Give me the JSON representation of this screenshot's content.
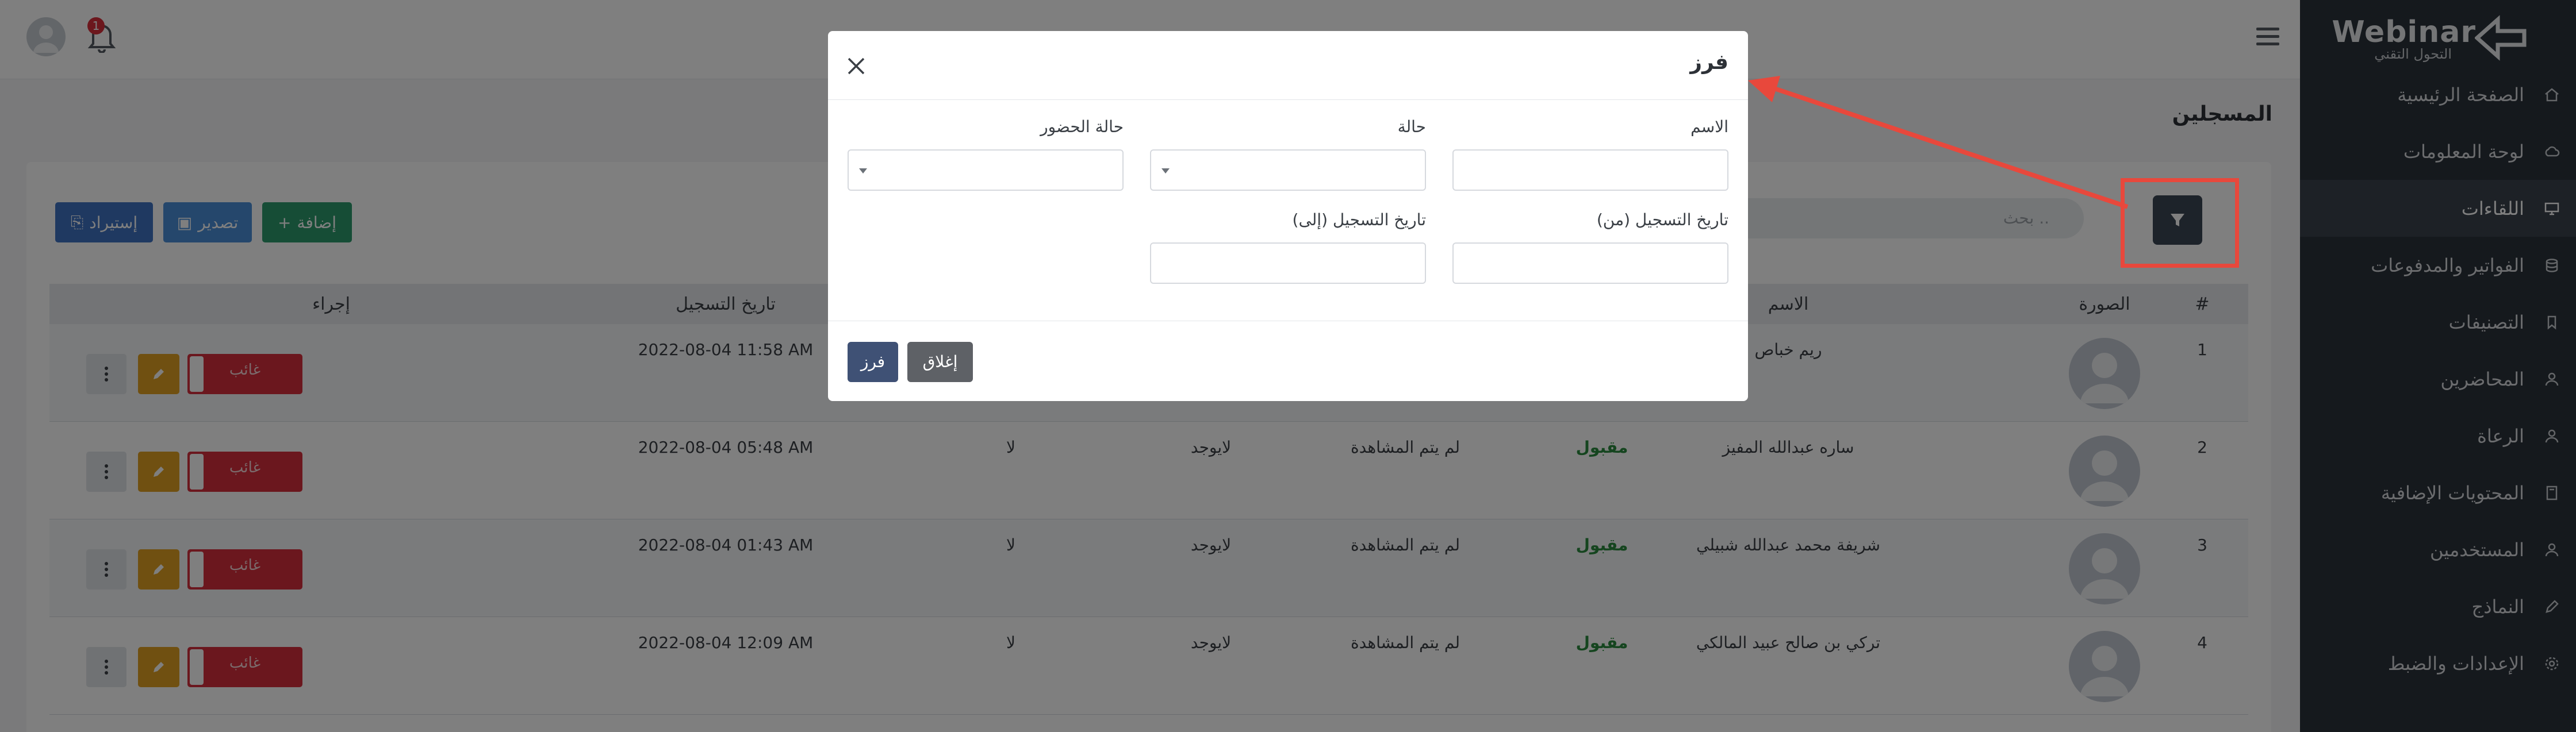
{
  "sidebar": {
    "logo_text": "Webinar",
    "logo_sub": "التحول التقني",
    "items": [
      {
        "label": "الصفحة الرئيسية",
        "icon": "home-icon"
      },
      {
        "label": "لوحة المعلومات",
        "icon": "cloud-icon"
      },
      {
        "label": "اللقاءات",
        "icon": "monitor-icon",
        "active": true
      },
      {
        "label": "الفواتير والمدفوعات",
        "icon": "database-icon"
      },
      {
        "label": "التصنيفات",
        "icon": "bookmark-icon"
      },
      {
        "label": "المحاضرين",
        "icon": "user-icon"
      },
      {
        "label": "الرعاة",
        "icon": "user-icon"
      },
      {
        "label": "المحتويات الإضافية",
        "icon": "book-icon"
      },
      {
        "label": "المستخدمين",
        "icon": "user-icon"
      },
      {
        "label": "النماذج",
        "icon": "edit-icon"
      },
      {
        "label": "الإعدادات والضبط",
        "icon": "gear-icon"
      }
    ]
  },
  "topbar": {
    "notification_count": "1"
  },
  "page": {
    "title": "المسجلين",
    "search_placeholder": "بحث ..",
    "add_label": "إضافة",
    "export_label": "تصدير",
    "import_label": "إستيراد"
  },
  "table": {
    "headers": {
      "num": "#",
      "photo": "الصورة",
      "name": "الاسم",
      "registration_date": "تاريخ التسجيل",
      "action": "إجراء"
    },
    "absent_label": "غائب",
    "rows": [
      {
        "num": "1",
        "name": "ريم خباص",
        "status": "",
        "watch": "",
        "cert": "",
        "paid": "",
        "date": "2022-08-04 11:58 AM"
      },
      {
        "num": "2",
        "name": "ساره عبدالله المفيز",
        "status": "مقبول",
        "watch": "لم يتم المشاهدة",
        "cert": "لايوجد",
        "paid": "لا",
        "date": "2022-08-04 05:48 AM"
      },
      {
        "num": "3",
        "name": "شريفة محمد عبدالله شبيلي",
        "status": "مقبول",
        "watch": "لم يتم المشاهدة",
        "cert": "لايوجد",
        "paid": "لا",
        "date": "2022-08-04 01:43 AM"
      },
      {
        "num": "4",
        "name": "تركي بن صالح عبيد المالكي",
        "status": "مقبول",
        "watch": "لم يتم المشاهدة",
        "cert": "لايوجد",
        "paid": "لا",
        "date": "2022-08-04 12:09 AM"
      }
    ]
  },
  "modal": {
    "title": "فرز",
    "fields": {
      "name_label": "الاسم",
      "status_label": "حالة",
      "attendance_label": "حالة الحضور",
      "date_from_label": "تاريخ التسجيل (من)",
      "date_to_label": "تاريخ التسجيل (إلى)"
    },
    "sort_button": "فرز",
    "close_button": "إغلاق"
  },
  "colors": {
    "sidebar_bg": "#2b323b",
    "highlight_red": "#e8483c",
    "absent_red": "#d72f3d",
    "edit_yellow": "#e0a022",
    "accepted_green": "#2b8a3e"
  }
}
